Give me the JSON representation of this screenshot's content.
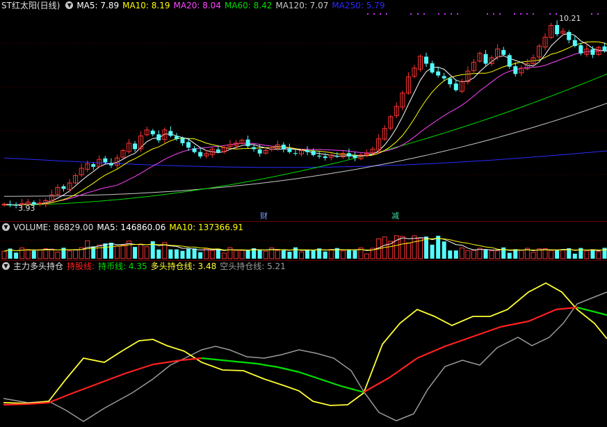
{
  "colors": {
    "up": "#ff3333",
    "down": "#54fcfc",
    "ma5": "#ffffff",
    "ma10": "#ffff00",
    "ma20": "#ff44ff",
    "ma60": "#00dd00",
    "ma120": "#c8c8c8",
    "ma250": "#2a2aff",
    "trend_up": "#ff2020",
    "trend_down": "#00e000",
    "long_line": "#ffff33",
    "short_line": "#9a9a9a"
  },
  "price_panel": {
    "stock_title": "ST红太阳(日线)",
    "indicators": [
      {
        "key": "MA5",
        "label": "MA5: 7.89",
        "color": "#ffffff"
      },
      {
        "key": "MA10",
        "label": "MA10: 8.19",
        "color": "#ffff00"
      },
      {
        "key": "MA20",
        "label": "MA20: 8.04",
        "color": "#ff44ff"
      },
      {
        "key": "MA60",
        "label": "MA60: 8.42",
        "color": "#00dd00"
      },
      {
        "key": "MA120",
        "label": "MA120: 7.07",
        "color": "#c8c8c8"
      },
      {
        "key": "MA250",
        "label": "MA250: 5.79",
        "color": "#2a2aff"
      }
    ],
    "high_label": "10.21",
    "low_label": "3.93",
    "events": [
      {
        "text": "财",
        "color": "#7f9cff"
      },
      {
        "text": "减",
        "color": "#40e0a0"
      }
    ]
  },
  "volume_panel": {
    "title": "VOLUME: 86829.00",
    "ma5_label": "MA5: 146860.06",
    "ma10_label": "MA10: 137366.91"
  },
  "position_panel": {
    "title": "主力多头持仓",
    "hold_line_label": "持股线:",
    "hold_cash_label": "持币线: 4.35",
    "long_label": "多头持仓线: 3.48",
    "short_label": "空头持仓线: 5.21"
  },
  "chart_data": {
    "type": "candlestick",
    "closes": [
      3.98,
      3.95,
      3.93,
      4.0,
      4.05,
      3.97,
      4.02,
      4.1,
      4.3,
      4.55,
      4.5,
      4.7,
      4.95,
      5.2,
      5.35,
      5.25,
      5.5,
      5.4,
      5.3,
      5.55,
      5.8,
      6.05,
      5.85,
      6.3,
      6.5,
      6.35,
      6.15,
      6.5,
      6.3,
      6.2,
      6.05,
      5.9,
      5.75,
      5.6,
      5.7,
      5.85,
      5.75,
      5.9,
      6.0,
      6.05,
      6.15,
      5.95,
      5.85,
      5.7,
      5.8,
      5.9,
      6.0,
      5.85,
      5.75,
      5.7,
      5.8,
      5.75,
      5.65,
      5.6,
      5.55,
      5.65,
      5.6,
      5.7,
      5.6,
      5.55,
      5.65,
      5.7,
      5.85,
      6.2,
      6.55,
      6.95,
      7.3,
      7.75,
      8.3,
      8.6,
      9.0,
      8.75,
      8.45,
      8.35,
      8.25,
      8.05,
      7.85,
      8.15,
      8.5,
      8.8,
      9.1,
      8.75,
      8.95,
      9.25,
      9.05,
      8.65,
      8.4,
      8.6,
      8.75,
      8.95,
      9.35,
      9.65,
      10.05,
      9.75,
      9.85,
      9.55,
      9.35,
      9.1,
      9.25,
      9.05,
      9.3,
      9.2,
      9.0
    ],
    "last": {
      "MA5": 7.89,
      "MA10": 8.19,
      "MA20": 8.04,
      "MA60": 8.42,
      "MA120": 7.07,
      "MA250": 5.79
    },
    "volume": {
      "last": 86829.0,
      "ma5": 146860.06,
      "ma10": 137366.91
    },
    "position": {
      "hold_cash": 4.35,
      "long": 3.48,
      "short": 5.21
    }
  }
}
